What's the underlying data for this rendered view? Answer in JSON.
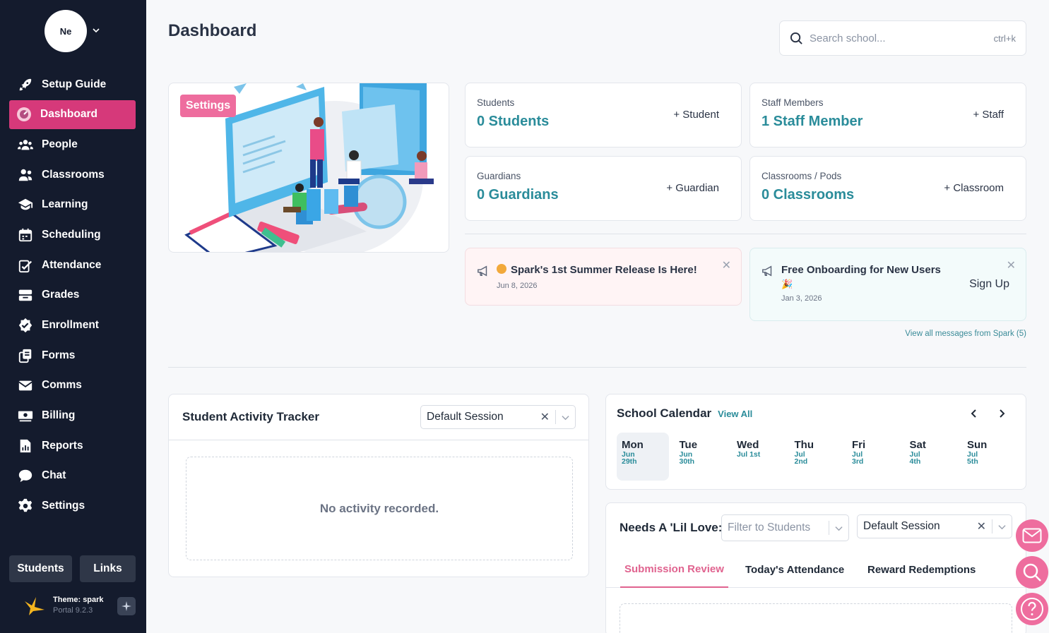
{
  "user": {
    "initials": "Ne"
  },
  "sidebar": {
    "items": [
      {
        "label": "Setup Guide",
        "icon": "rocket-icon"
      },
      {
        "label": "Dashboard",
        "icon": "dashboard-icon",
        "active": true
      },
      {
        "label": "People",
        "icon": "people-icon"
      },
      {
        "label": "Classrooms",
        "icon": "classroom-icon"
      },
      {
        "label": "Learning",
        "icon": "graduation-cap-icon"
      },
      {
        "label": "Scheduling",
        "icon": "calendar-icon"
      },
      {
        "label": "Attendance",
        "icon": "clipboard-check-icon"
      },
      {
        "label": "Grades",
        "icon": "inbox-tray-icon"
      },
      {
        "label": "Enrollment",
        "icon": "badge-check-icon"
      },
      {
        "label": "Forms",
        "icon": "forms-icon"
      },
      {
        "label": "Comms",
        "icon": "envelope-icon"
      },
      {
        "label": "Billing",
        "icon": "money-icon"
      },
      {
        "label": "Reports",
        "icon": "chart-file-icon"
      },
      {
        "label": "Chat",
        "icon": "chat-icon"
      },
      {
        "label": "Settings",
        "icon": "gear-icon"
      }
    ],
    "students_btn": "Students",
    "links_btn": "Links",
    "theme_label": "Theme:",
    "theme_name": "spark",
    "portal_version": "Portal 9.2.3"
  },
  "header": {
    "title": "Dashboard",
    "search_placeholder": "Search school...",
    "search_shortcut": "ctrl+k"
  },
  "hero": {
    "settings_label": "Settings"
  },
  "stats": {
    "students": {
      "label": "Students",
      "value": "0 Students",
      "add": "+ Student"
    },
    "staff": {
      "label": "Staff Members",
      "value": "1 Staff Member",
      "add": "+ Staff"
    },
    "guardians": {
      "label": "Guardians",
      "value": "0 Guardians",
      "add": "+ Guardian"
    },
    "classrooms": {
      "label": "Classrooms / Pods",
      "value": "0 Classrooms",
      "add": "+ Classroom"
    }
  },
  "messages": {
    "m1": {
      "title": "Spark's 1st Summer Release Is Here!",
      "date": "Jun 8, 2026"
    },
    "m2": {
      "title": "Free Onboarding for New Users",
      "date": "Jan 3, 2026",
      "action": "Sign Up"
    },
    "view_all": "View all messages from Spark (5)"
  },
  "tracker": {
    "title": "Student Activity Tracker",
    "session": "Default Session",
    "empty": "No activity recorded."
  },
  "calendar": {
    "title": "School Calendar",
    "view_all": "View All",
    "days": [
      {
        "name": "Mon",
        "month": "Jun",
        "date": "29th"
      },
      {
        "name": "Tue",
        "month": "Jun",
        "date": "30th"
      },
      {
        "name": "Wed",
        "month": "Jul 1st",
        "date": ""
      },
      {
        "name": "Thu",
        "month": "Jul",
        "date": "2nd"
      },
      {
        "name": "Fri",
        "month": "Jul",
        "date": "3rd"
      },
      {
        "name": "Sat",
        "month": "Jul",
        "date": "4th"
      },
      {
        "name": "Sun",
        "month": "Jul",
        "date": "5th"
      }
    ]
  },
  "love": {
    "title": "Needs A 'Lil Love:",
    "filter_placeholder": "Filter to Students",
    "session": "Default Session",
    "tabs": [
      "Submission Review",
      "Today's Attendance",
      "Reward Redemptions"
    ]
  },
  "colors": {
    "sidebar": "#141b2d",
    "accent": "#d6397a",
    "teal": "#2a8c9a",
    "fab": "#ee6d9e"
  }
}
